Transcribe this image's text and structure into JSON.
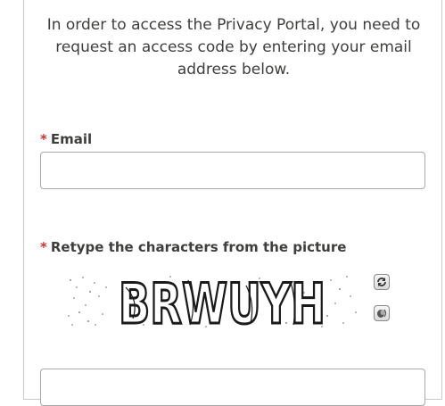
{
  "intro": {
    "line1": "In order to access the Privacy Portal, you need to",
    "line2": "request an access code by entering your email",
    "line3": "address below."
  },
  "email_field": {
    "required_marker": "*",
    "label": "Email",
    "value": ""
  },
  "captcha": {
    "required_marker": "*",
    "label": "Retype the characters from the picture",
    "image_text": "BRWUYH",
    "refresh_icon": "refresh-icon",
    "audio_icon": "audio-icon",
    "input_value": ""
  },
  "colors": {
    "required": "#c23934",
    "text": "#3e3e3c",
    "border": "#a8a8a8"
  }
}
